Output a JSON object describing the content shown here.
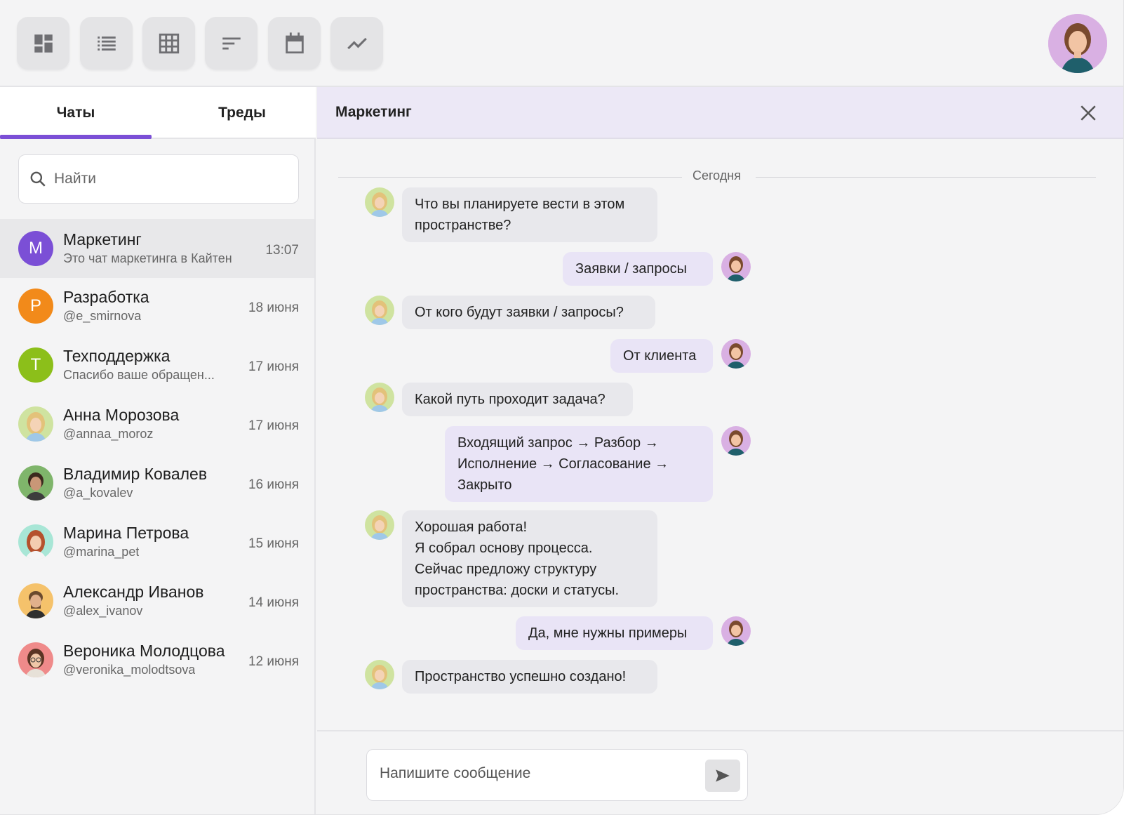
{
  "toolbar": {
    "buttons": [
      {
        "icon": "dashboard-icon"
      },
      {
        "icon": "list-icon"
      },
      {
        "icon": "grid-icon"
      },
      {
        "icon": "sort-icon"
      },
      {
        "icon": "calendar-icon"
      },
      {
        "icon": "chart-line-icon"
      }
    ]
  },
  "sidebar": {
    "tabs": [
      "Чаты",
      "Треды"
    ],
    "active_tab": "Чаты",
    "search_placeholder": "Найти",
    "chats": [
      {
        "name": "Маркетинг",
        "sub": "Это чат маркетинга в Кайтен",
        "time": "13:07",
        "letter": "М",
        "color": "#7b4fd6",
        "active": true
      },
      {
        "name": "Разработка",
        "sub": "@e_smirnova",
        "time": "18 июня",
        "letter": "Р",
        "color": "#f28a1a"
      },
      {
        "name": "Техподдержка",
        "sub": "Спасибо ваше обращен...",
        "time": "17 июня",
        "letter": "Т",
        "color": "#8cbf1a"
      },
      {
        "name": "Анна Морозова",
        "sub": "@annaa_moroz",
        "time": "17 июня"
      },
      {
        "name": "Владимир Ковалев",
        "sub": "@a_kovalev",
        "time": "16 июня"
      },
      {
        "name": "Марина Петрова",
        "sub": "@marina_pet",
        "time": "15 июня"
      },
      {
        "name": "Александр Иванов",
        "sub": "@alex_ivanov",
        "time": "14 июня"
      },
      {
        "name": "Вероника Молодцова",
        "sub": "@veronika_molodtsova",
        "time": "12 июня"
      }
    ]
  },
  "main": {
    "title": "Маркетинг",
    "divider": "Сегодня",
    "messages": [
      {
        "dir": "in",
        "lines": [
          "Что вы планируете вести в этом",
          "пространстве?"
        ]
      },
      {
        "dir": "out",
        "lines": [
          "Заявки / запросы"
        ]
      },
      {
        "dir": "in",
        "lines": [
          "От кого будут заявки / запросы?"
        ]
      },
      {
        "dir": "out",
        "lines": [
          "От клиента"
        ]
      },
      {
        "dir": "in",
        "lines": [
          "Какой путь проходит задача?"
        ]
      },
      {
        "dir": "out",
        "lines": [
          "Входящий запрос → Разбор →",
          "Исполнение → Согласование →",
          "Закрыто"
        ]
      },
      {
        "dir": "in",
        "lines": [
          "Хорошая работа!",
          "Я собрал основу процесса.",
          "Сейчас предложу структуру",
          "пространства: доски и статусы."
        ]
      },
      {
        "dir": "out",
        "lines": [
          "Да, мне нужны примеры"
        ]
      },
      {
        "dir": "in",
        "lines": [
          "Пространство успешно создано!"
        ]
      }
    ],
    "composer_placeholder": "Напишите сообщение"
  },
  "colors": {
    "accent": "#7b4fd6",
    "header_bg": "#ece8f6",
    "outgoing_bubble": "#e9e4f6",
    "incoming_bubble": "#e8e8ec"
  }
}
